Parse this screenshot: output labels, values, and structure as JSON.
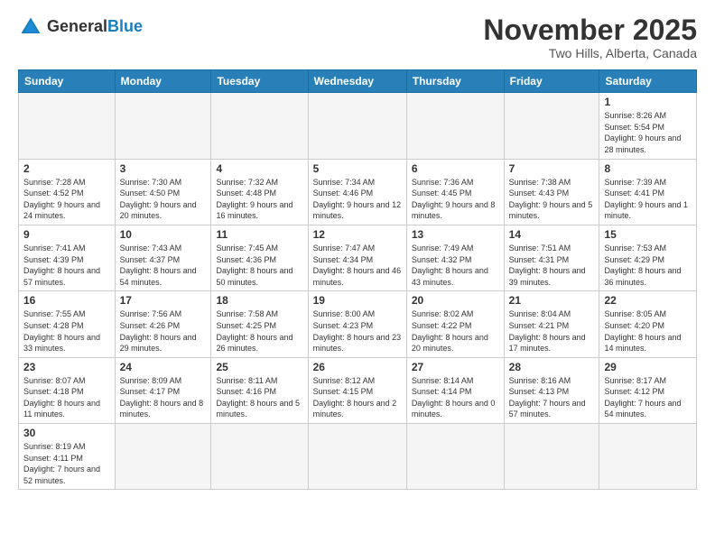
{
  "logo": {
    "text_general": "General",
    "text_blue": "Blue"
  },
  "title": "November 2025",
  "location": "Two Hills, Alberta, Canada",
  "weekdays": [
    "Sunday",
    "Monday",
    "Tuesday",
    "Wednesday",
    "Thursday",
    "Friday",
    "Saturday"
  ],
  "weeks": [
    [
      {
        "day": "",
        "info": ""
      },
      {
        "day": "",
        "info": ""
      },
      {
        "day": "",
        "info": ""
      },
      {
        "day": "",
        "info": ""
      },
      {
        "day": "",
        "info": ""
      },
      {
        "day": "",
        "info": ""
      },
      {
        "day": "1",
        "info": "Sunrise: 8:26 AM\nSunset: 5:54 PM\nDaylight: 9 hours\nand 28 minutes."
      }
    ],
    [
      {
        "day": "2",
        "info": "Sunrise: 7:28 AM\nSunset: 4:52 PM\nDaylight: 9 hours\nand 24 minutes."
      },
      {
        "day": "3",
        "info": "Sunrise: 7:30 AM\nSunset: 4:50 PM\nDaylight: 9 hours\nand 20 minutes."
      },
      {
        "day": "4",
        "info": "Sunrise: 7:32 AM\nSunset: 4:48 PM\nDaylight: 9 hours\nand 16 minutes."
      },
      {
        "day": "5",
        "info": "Sunrise: 7:34 AM\nSunset: 4:46 PM\nDaylight: 9 hours\nand 12 minutes."
      },
      {
        "day": "6",
        "info": "Sunrise: 7:36 AM\nSunset: 4:45 PM\nDaylight: 9 hours\nand 8 minutes."
      },
      {
        "day": "7",
        "info": "Sunrise: 7:38 AM\nSunset: 4:43 PM\nDaylight: 9 hours\nand 5 minutes."
      },
      {
        "day": "8",
        "info": "Sunrise: 7:39 AM\nSunset: 4:41 PM\nDaylight: 9 hours\nand 1 minute."
      }
    ],
    [
      {
        "day": "9",
        "info": "Sunrise: 7:41 AM\nSunset: 4:39 PM\nDaylight: 8 hours\nand 57 minutes."
      },
      {
        "day": "10",
        "info": "Sunrise: 7:43 AM\nSunset: 4:37 PM\nDaylight: 8 hours\nand 54 minutes."
      },
      {
        "day": "11",
        "info": "Sunrise: 7:45 AM\nSunset: 4:36 PM\nDaylight: 8 hours\nand 50 minutes."
      },
      {
        "day": "12",
        "info": "Sunrise: 7:47 AM\nSunset: 4:34 PM\nDaylight: 8 hours\nand 46 minutes."
      },
      {
        "day": "13",
        "info": "Sunrise: 7:49 AM\nSunset: 4:32 PM\nDaylight: 8 hours\nand 43 minutes."
      },
      {
        "day": "14",
        "info": "Sunrise: 7:51 AM\nSunset: 4:31 PM\nDaylight: 8 hours\nand 39 minutes."
      },
      {
        "day": "15",
        "info": "Sunrise: 7:53 AM\nSunset: 4:29 PM\nDaylight: 8 hours\nand 36 minutes."
      }
    ],
    [
      {
        "day": "16",
        "info": "Sunrise: 7:55 AM\nSunset: 4:28 PM\nDaylight: 8 hours\nand 33 minutes."
      },
      {
        "day": "17",
        "info": "Sunrise: 7:56 AM\nSunset: 4:26 PM\nDaylight: 8 hours\nand 29 minutes."
      },
      {
        "day": "18",
        "info": "Sunrise: 7:58 AM\nSunset: 4:25 PM\nDaylight: 8 hours\nand 26 minutes."
      },
      {
        "day": "19",
        "info": "Sunrise: 8:00 AM\nSunset: 4:23 PM\nDaylight: 8 hours\nand 23 minutes."
      },
      {
        "day": "20",
        "info": "Sunrise: 8:02 AM\nSunset: 4:22 PM\nDaylight: 8 hours\nand 20 minutes."
      },
      {
        "day": "21",
        "info": "Sunrise: 8:04 AM\nSunset: 4:21 PM\nDaylight: 8 hours\nand 17 minutes."
      },
      {
        "day": "22",
        "info": "Sunrise: 8:05 AM\nSunset: 4:20 PM\nDaylight: 8 hours\nand 14 minutes."
      }
    ],
    [
      {
        "day": "23",
        "info": "Sunrise: 8:07 AM\nSunset: 4:18 PM\nDaylight: 8 hours\nand 11 minutes."
      },
      {
        "day": "24",
        "info": "Sunrise: 8:09 AM\nSunset: 4:17 PM\nDaylight: 8 hours\nand 8 minutes."
      },
      {
        "day": "25",
        "info": "Sunrise: 8:11 AM\nSunset: 4:16 PM\nDaylight: 8 hours\nand 5 minutes."
      },
      {
        "day": "26",
        "info": "Sunrise: 8:12 AM\nSunset: 4:15 PM\nDaylight: 8 hours\nand 2 minutes."
      },
      {
        "day": "27",
        "info": "Sunrise: 8:14 AM\nSunset: 4:14 PM\nDaylight: 8 hours\nand 0 minutes."
      },
      {
        "day": "28",
        "info": "Sunrise: 8:16 AM\nSunset: 4:13 PM\nDaylight: 7 hours\nand 57 minutes."
      },
      {
        "day": "29",
        "info": "Sunrise: 8:17 AM\nSunset: 4:12 PM\nDaylight: 7 hours\nand 54 minutes."
      }
    ],
    [
      {
        "day": "30",
        "info": "Sunrise: 8:19 AM\nSunset: 4:11 PM\nDaylight: 7 hours\nand 52 minutes."
      },
      {
        "day": "",
        "info": ""
      },
      {
        "day": "",
        "info": ""
      },
      {
        "day": "",
        "info": ""
      },
      {
        "day": "",
        "info": ""
      },
      {
        "day": "",
        "info": ""
      },
      {
        "day": "",
        "info": ""
      }
    ]
  ]
}
